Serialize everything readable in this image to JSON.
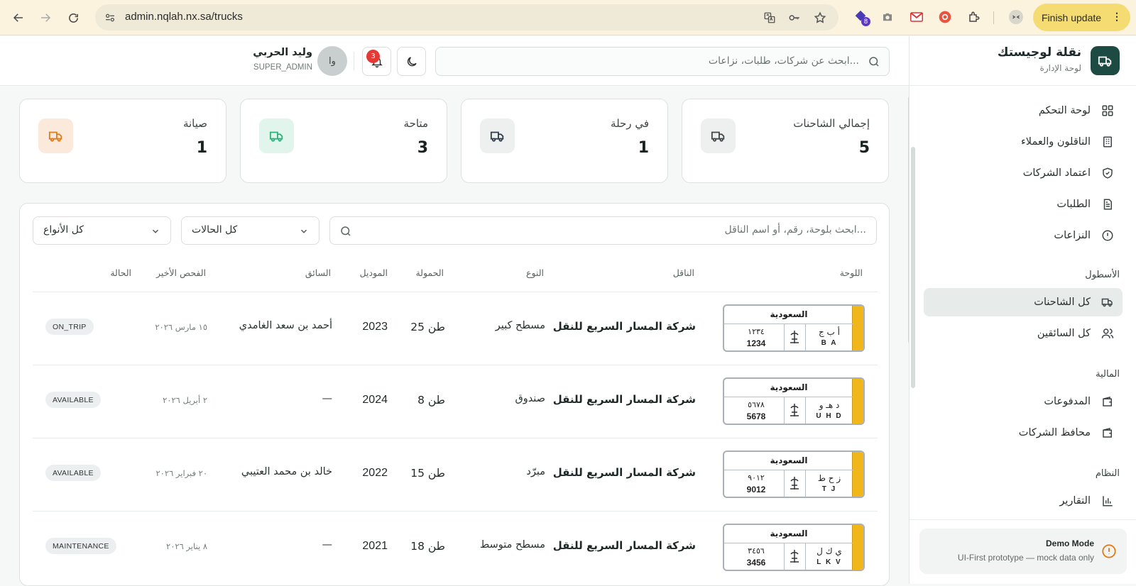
{
  "browser": {
    "url": "admin.nqlah.nx.sa/trucks",
    "extension_badge": "8",
    "finish_update_label": "Finish update"
  },
  "sidebar": {
    "brand_title": "نقلة لوجيستك",
    "brand_subtitle": "لوحة الإدارة",
    "items_main": [
      {
        "label": "لوحة التحكم",
        "icon": "dashboard-icon"
      },
      {
        "label": "الناقلون والعملاء",
        "icon": "building-icon"
      },
      {
        "label": "اعتماد الشركات",
        "icon": "shield-check-icon"
      },
      {
        "label": "الطلبات",
        "icon": "document-icon"
      },
      {
        "label": "النزاعات",
        "icon": "alert-circle-icon"
      }
    ],
    "section_fleet": "الأسطول",
    "items_fleet": [
      {
        "label": "كل الشاحنات",
        "icon": "truck-icon",
        "active": true
      },
      {
        "label": "كل السائقين",
        "icon": "users-icon"
      }
    ],
    "section_finance": "المالية",
    "items_finance": [
      {
        "label": "المدفوعات",
        "icon": "wallet-icon"
      },
      {
        "label": "محافظ الشركات",
        "icon": "wallet-icon"
      }
    ],
    "section_system": "النظام",
    "items_system": [
      {
        "label": "التقارير",
        "icon": "bar-chart-icon"
      }
    ],
    "demo_title": "Demo Mode",
    "demo_subtitle": "UI-First prototype — mock data only"
  },
  "header": {
    "search_placeholder": "ابحث عن شركات، طلبات، نزاعات...",
    "notification_count": "3",
    "user_initials": "وا",
    "user_name": "وليد الحربي",
    "user_role": "SUPER_ADMIN"
  },
  "stats": [
    {
      "label": "إجمالي الشاحنات",
      "value": "5",
      "color": "#5b6463",
      "bg": "#eef0f0"
    },
    {
      "label": "في رحلة",
      "value": "1",
      "color": "#3a4a5a",
      "bg": "#eef0f0"
    },
    {
      "label": "متاحة",
      "value": "3",
      "color": "#2fb27a",
      "bg": "#e2f5ec"
    },
    {
      "label": "صيانة",
      "value": "1",
      "color": "#e07b18",
      "bg": "#fbeadb"
    }
  ],
  "filters": {
    "search_placeholder": "ابحث بلوحة، رقم، أو اسم الناقل...",
    "status_value": "كل الحالات",
    "type_value": "كل الأنواع"
  },
  "table": {
    "headers": {
      "plate": "اللوحة",
      "carrier": "الناقل",
      "type": "النوع",
      "capacity": "الحمولة",
      "model": "الموديل",
      "driver": "السائق",
      "last_inspection": "الفحص الأخير",
      "status": "الحالة"
    },
    "rows": [
      {
        "plate": {
          "country": "السعودية",
          "num_ar": "١٢٣٤",
          "num_en": "1234",
          "let_ar": "أ ب ج",
          "let_en": "B A"
        },
        "carrier": "شركة المسار السريع للنقل",
        "type": "مسطح كبير",
        "capacity": "25 طن",
        "model": "2023",
        "driver": "أحمد بن سعد الغامدي",
        "inspection": "١٥ مارس ٢٠٢٦",
        "status": "ON_TRIP"
      },
      {
        "plate": {
          "country": "السعودية",
          "num_ar": "٥٦٧٨",
          "num_en": "5678",
          "let_ar": "د هـ و",
          "let_en": "U H D"
        },
        "carrier": "شركة المسار السريع للنقل",
        "type": "صندوق",
        "capacity": "8 طن",
        "model": "2024",
        "driver": "—",
        "inspection": "٢ أبريل ٢٠٢٦",
        "status": "AVAILABLE"
      },
      {
        "plate": {
          "country": "السعودية",
          "num_ar": "٩٠١٢",
          "num_en": "9012",
          "let_ar": "ز ح ط",
          "let_en": "T J"
        },
        "carrier": "شركة المسار السريع للنقل",
        "type": "مبرّد",
        "capacity": "15 طن",
        "model": "2022",
        "driver": "خالد بن محمد العتيبي",
        "inspection": "٢٠ فبراير ٢٠٢٦",
        "status": "AVAILABLE"
      },
      {
        "plate": {
          "country": "السعودية",
          "num_ar": "٣٤٥٦",
          "num_en": "3456",
          "let_ar": "ي ك ل",
          "let_en": "L K V"
        },
        "carrier": "شركة المسار السريع للنقل",
        "type": "مسطح متوسط",
        "capacity": "18 طن",
        "model": "2021",
        "driver": "—",
        "inspection": "٨ يناير ٢٠٢٦",
        "status": "MAINTENANCE"
      }
    ]
  }
}
